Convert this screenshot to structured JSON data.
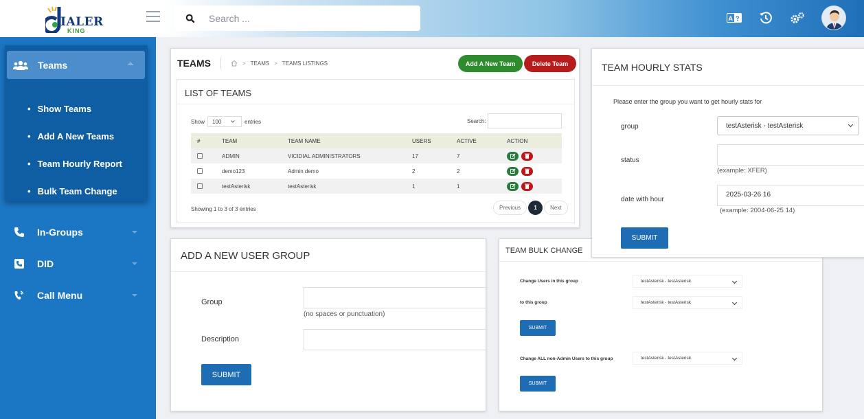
{
  "header": {
    "logo_text": "IALER",
    "logo_sub": "KING",
    "search_placeholder": "Search ...",
    "icons": [
      "translate-icon",
      "history-icon",
      "settings-icon",
      "avatar"
    ]
  },
  "sidebar": {
    "teams_label": "Teams",
    "sub_items": [
      "Show Teams",
      "Add A New Teams",
      "Team Hourly Report",
      "Bulk Team Change"
    ],
    "items": [
      {
        "label": "In-Groups",
        "icon": "phone-icon"
      },
      {
        "label": "DID",
        "icon": "phone-square-icon"
      },
      {
        "label": "Call Menu",
        "icon": "phone-volume-icon"
      }
    ]
  },
  "teams": {
    "title": "TEAMS",
    "breadcrumb": [
      "TEAMS",
      "TEAMS LISTINGS"
    ],
    "add_button": "Add A New Team",
    "delete_button": "Delete Team",
    "panel_title": "LIST OF TEAMS",
    "show_label": "Show",
    "entries_value": "100",
    "entries_label": "entries",
    "search_label": "Search:",
    "columns": [
      "#",
      "TEAM",
      "TEAM NAME",
      "USERS",
      "ACTIVE",
      "ACTION"
    ],
    "rows": [
      {
        "team": "ADMIN",
        "name": "VICIDIAL ADMINISTRATORS",
        "users": "17",
        "active": "7"
      },
      {
        "team": "demo123",
        "name": "Admin demo",
        "users": "2",
        "active": "2"
      },
      {
        "team": "testAsterisk",
        "name": "testAsterisk",
        "users": "1",
        "active": "1"
      }
    ],
    "info": "Showing 1 to 3 of 3 entries",
    "prev": "Previous",
    "page": "1",
    "next": "Next"
  },
  "add_group": {
    "title": "ADD A NEW USER GROUP",
    "group_label": "Group",
    "group_help": "(no spaces or punctuation)",
    "description_label": "Description",
    "submit": "SUBMIT"
  },
  "bulk": {
    "title": "TEAM BULK CHANGE",
    "change_users_label": "Change Users in this group",
    "change_users_value": "testAsterisk - testAsterisk",
    "to_group_label": "to this group",
    "to_group_value": "testAsterisk - testAsterisk",
    "submit1": "SUBMIT",
    "change_all_label": "Change ALL non-Admin Users to this group",
    "change_all_value": "testAsterisk - testAsterisk",
    "submit2": "SUBMIT"
  },
  "hourly": {
    "title": "TEAM HOURLY STATS",
    "intro": "Please enter the group you want to get hourly stats for",
    "group_label": "group",
    "group_value": "testAsterisk - testAsterisk",
    "status_label": "status",
    "status_help": "(example: XFER)",
    "date_label": "date with hour",
    "date_value": "2025-03-26 16",
    "date_help": "(example: 2004-06-25 14)",
    "submit": "SUBMIT"
  }
}
